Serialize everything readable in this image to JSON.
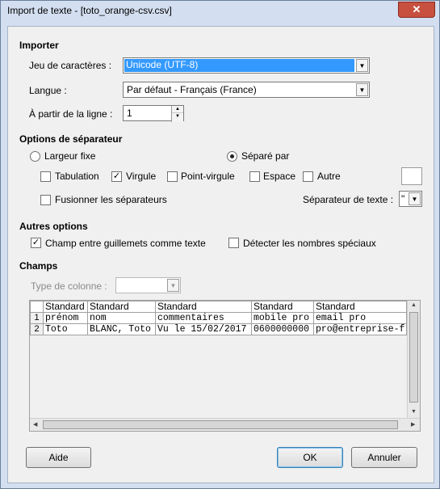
{
  "window": {
    "title": "Import de texte - [toto_orange-csv.csv]",
    "close_glyph": "✕"
  },
  "importer": {
    "heading": "Importer",
    "charset_label": "Jeu de caractères :",
    "charset_value": "Unicode (UTF-8)",
    "lang_label": "Langue :",
    "lang_value": "Par défaut - Français (France)",
    "fromline_label": "À partir de la ligne :",
    "fromline_value": "1"
  },
  "separator": {
    "heading": "Options de séparateur",
    "fixed_width": "Largeur fixe",
    "separated_by": "Séparé par",
    "tab": "Tabulation",
    "comma": "Virgule",
    "semicolon": "Point-virgule",
    "space": "Espace",
    "other": "Autre",
    "merge": "Fusionner les séparateurs",
    "text_sep_label": "Séparateur de texte :",
    "text_sep_value": "\""
  },
  "other_options": {
    "heading": "Autres options",
    "quoted_as_text": "Champ entre guillemets comme texte",
    "detect_special": "Détecter les nombres spéciaux"
  },
  "fields": {
    "heading": "Champs",
    "col_type_label": "Type de colonne :",
    "headers": [
      "Standard",
      "Standard",
      "Standard",
      "Standard",
      "Standard"
    ],
    "rows": [
      {
        "n": "1",
        "cells": [
          "prénom",
          "nom",
          "commentaires",
          "mobile pro",
          "email pro"
        ]
      },
      {
        "n": "2",
        "cells": [
          "Toto",
          "BLANC, Toto",
          "Vu le 15/02/2017",
          "0600000000",
          "pro@entreprise-f"
        ]
      }
    ]
  },
  "buttons": {
    "help": "Aide",
    "ok": "OK",
    "cancel": "Annuler"
  }
}
